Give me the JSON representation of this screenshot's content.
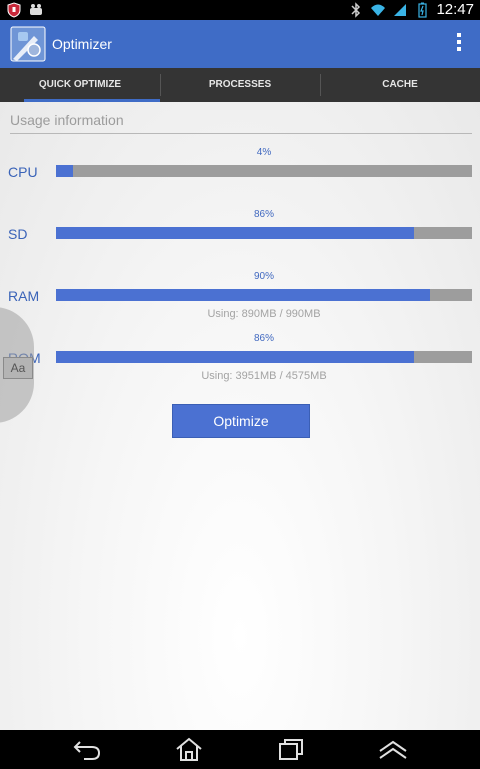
{
  "status_bar": {
    "time": "12:47",
    "icons": [
      "shield-icon",
      "android-icon",
      "bluetooth-icon",
      "wifi-icon",
      "battery-icon"
    ]
  },
  "action_bar": {
    "title": "Optimizer",
    "icon": "optimizer-app-icon",
    "overflow_icon": "overflow-menu-icon"
  },
  "tabs": [
    {
      "label": "QUICK OPTIMIZE",
      "active": true
    },
    {
      "label": "PROCESSES",
      "active": false
    },
    {
      "label": "CACHE",
      "active": false
    }
  ],
  "content": {
    "section_header": "Usage information",
    "rows": [
      {
        "label": "CPU",
        "percent_text": "4%",
        "percent": 4,
        "usage": ""
      },
      {
        "label": "SD",
        "percent_text": "86%",
        "percent": 86,
        "usage": ""
      },
      {
        "label": "RAM",
        "percent_text": "90%",
        "percent": 90,
        "usage": "Using: 890MB / 990MB"
      },
      {
        "label": "ROM",
        "percent_text": "86%",
        "percent": 86,
        "usage": "Using: 3951MB / 4575MB"
      }
    ],
    "optimize_button": "Optimize",
    "side_handle_label": "Aa"
  },
  "colors": {
    "accent": "#3f6cc6",
    "bar_fill": "#4b71d2",
    "bar_track": "#9d9d9d",
    "tab_bar": "#343434"
  },
  "nav_bar": {
    "icons": [
      "back-icon",
      "home-icon",
      "recent-apps-icon",
      "menu-up-icon"
    ]
  }
}
